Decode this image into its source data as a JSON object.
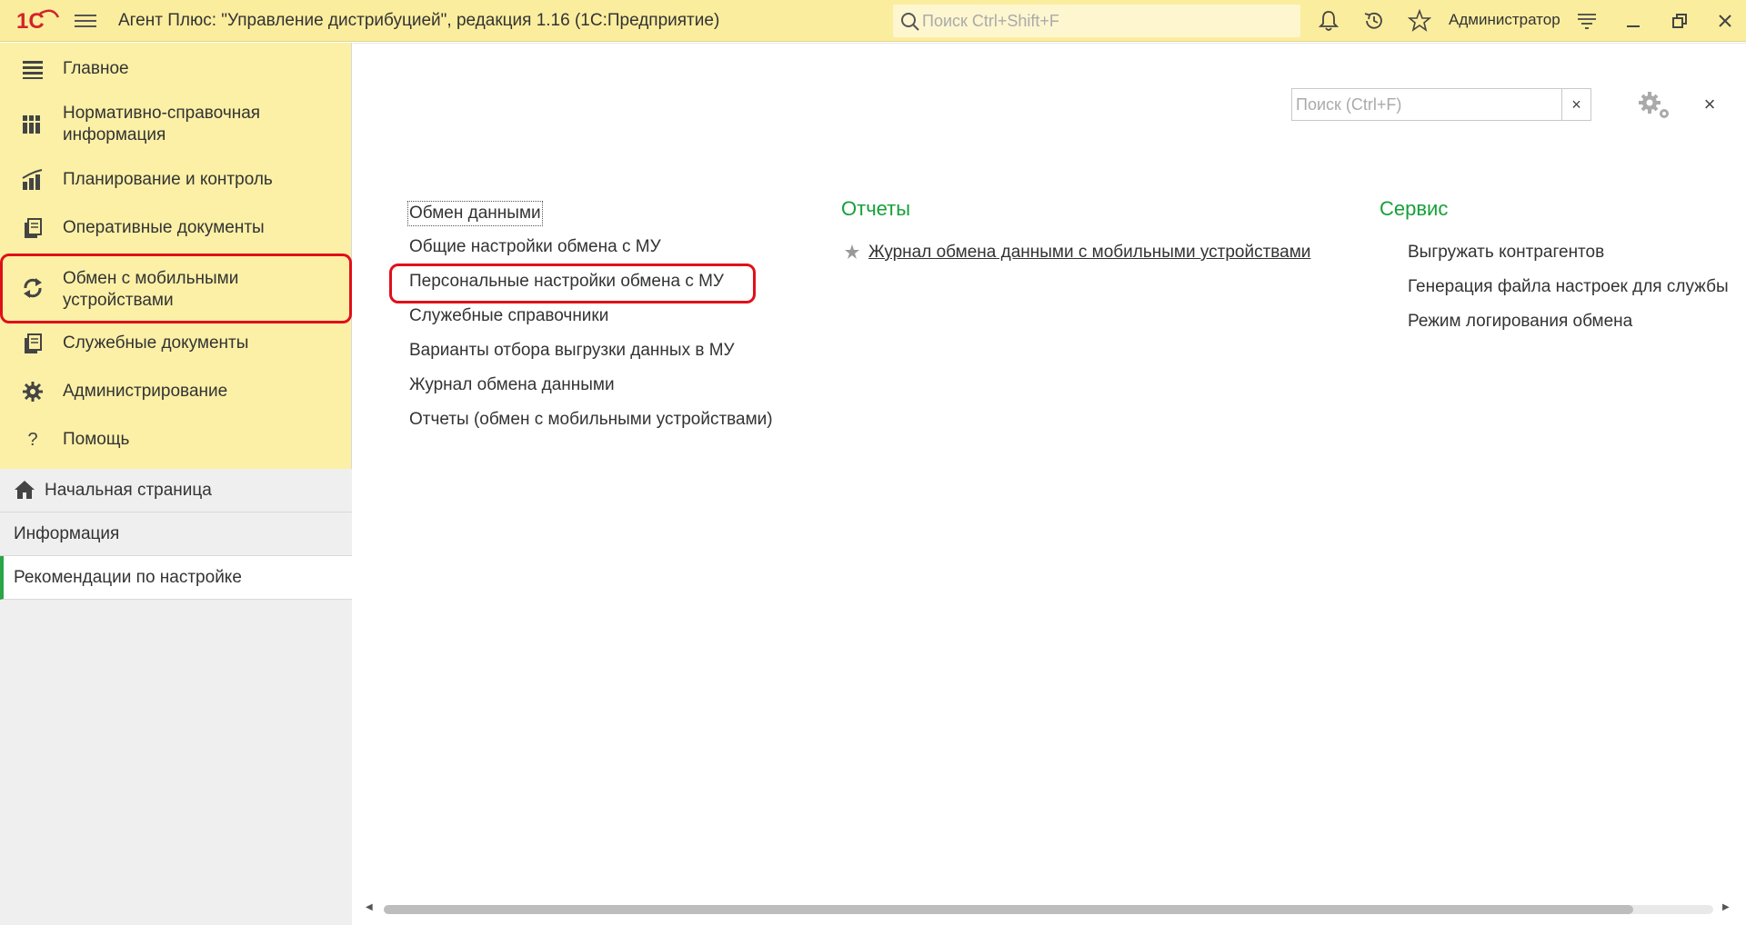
{
  "app": {
    "title": "Агент Плюс: \"Управление дистрибуцией\", редакция 1.16  (1С:Предприятие)",
    "search_placeholder": "Поиск Ctrl+Shift+F",
    "user": "Администратор",
    "logo_text": "1С"
  },
  "sidebar": {
    "items": [
      {
        "label": "Главное",
        "icon": "list-lines-icon"
      },
      {
        "label": "Нормативно-справочная информация",
        "icon": "books-icon"
      },
      {
        "label": "Планирование и контроль",
        "icon": "bar-chart-icon"
      },
      {
        "label": "Оперативные документы",
        "icon": "documents-icon"
      },
      {
        "label": "Обмен с мобильными устройствами",
        "icon": "sync-icon",
        "highlighted": true
      },
      {
        "label": "Служебные документы",
        "icon": "documents-icon"
      },
      {
        "label": "Администрирование",
        "icon": "gear-icon"
      },
      {
        "label": "Помощь",
        "icon": "question-icon"
      }
    ],
    "lower": [
      {
        "label": "Начальная страница",
        "icon": "home-icon"
      },
      {
        "label": "Информация"
      },
      {
        "label": "Рекомендации по настройке",
        "selected": true
      }
    ]
  },
  "content": {
    "search_placeholder": "Поиск (Ctrl+F)",
    "clear_symbol": "×",
    "close_symbol": "×",
    "column1": {
      "links": [
        "Обмен данными",
        "Общие настройки обмена с МУ",
        "Персональные настройки обмена с МУ",
        "Служебные справочники",
        "Варианты отбора выгрузки данных в МУ",
        "Журнал обмена данными",
        "Отчеты (обмен с мобильными устройствами)"
      ]
    },
    "column2": {
      "heading": "Отчеты",
      "links": [
        "Журнал обмена данными с мобильными устройствами"
      ]
    },
    "column3": {
      "heading": "Сервис",
      "links": [
        "Выгружать контрагентов",
        "Генерация файла настроек для службы",
        "Режим логирования обмена"
      ]
    }
  },
  "scrollbar": {
    "position_fraction": 0.0,
    "visible_fraction": 0.94
  },
  "colors": {
    "topbar": "#fbed9e",
    "sidebar": "#fbf0a6",
    "accent_green": "#15a03a",
    "highlight_red": "#e0101a",
    "logo_red": "#d2232a"
  }
}
